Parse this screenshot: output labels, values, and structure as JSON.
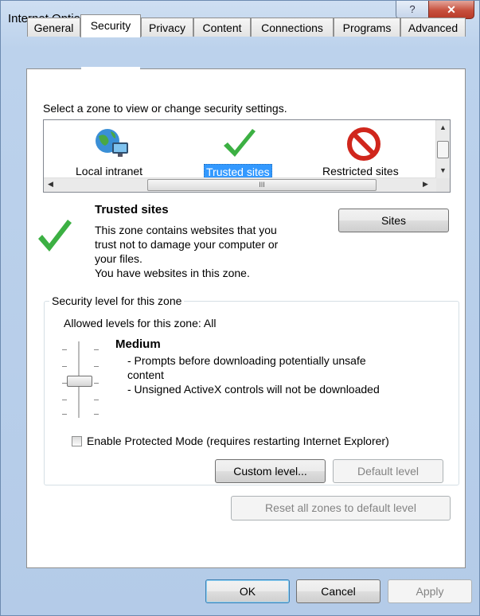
{
  "window": {
    "title": "Internet Options",
    "help_glyph": "?",
    "close_glyph": "✕"
  },
  "tabs": [
    {
      "label": "General",
      "active": false
    },
    {
      "label": "Security",
      "active": true
    },
    {
      "label": "Privacy",
      "active": false
    },
    {
      "label": "Content",
      "active": false
    },
    {
      "label": "Connections",
      "active": false
    },
    {
      "label": "Programs",
      "active": false
    },
    {
      "label": "Advanced",
      "active": false
    }
  ],
  "zones": {
    "prompt": "Select a zone to view or change security settings.",
    "items": [
      {
        "label": "Local intranet",
        "icon": "local-intranet-icon",
        "selected": false
      },
      {
        "label": "Trusted sites",
        "icon": "trusted-sites-icon",
        "selected": true
      },
      {
        "label": "Restricted sites",
        "icon": "restricted-sites-icon",
        "selected": false
      }
    ],
    "scroll_grip": "III"
  },
  "zone_info": {
    "title": "Trusted sites",
    "description_lines": [
      "This zone contains websites that you",
      "trust not to damage your computer or",
      "your files.",
      "You have websites in this zone."
    ],
    "sites_button": "Sites"
  },
  "security_level": {
    "legend": "Security level for this zone",
    "allowed": "Allowed levels for this zone: All",
    "level_name": "Medium",
    "details": [
      "- Prompts before downloading potentially unsafe",
      "content",
      "- Unsigned ActiveX controls will not be downloaded"
    ],
    "slider_level": "Medium",
    "protected_mode_label": "Enable Protected Mode (requires restarting Internet Explorer)",
    "protected_mode_checked": false,
    "custom_level_button": "Custom level...",
    "default_level_button": "Default level"
  },
  "reset_all_button": "Reset all zones to default level",
  "footer": {
    "ok": "OK",
    "cancel": "Cancel",
    "apply": "Apply"
  },
  "colors": {
    "accent": "#3399ff",
    "check_green": "#3cb043",
    "restricted_red": "#d0261c",
    "title_blue": "#bcd2ec"
  }
}
